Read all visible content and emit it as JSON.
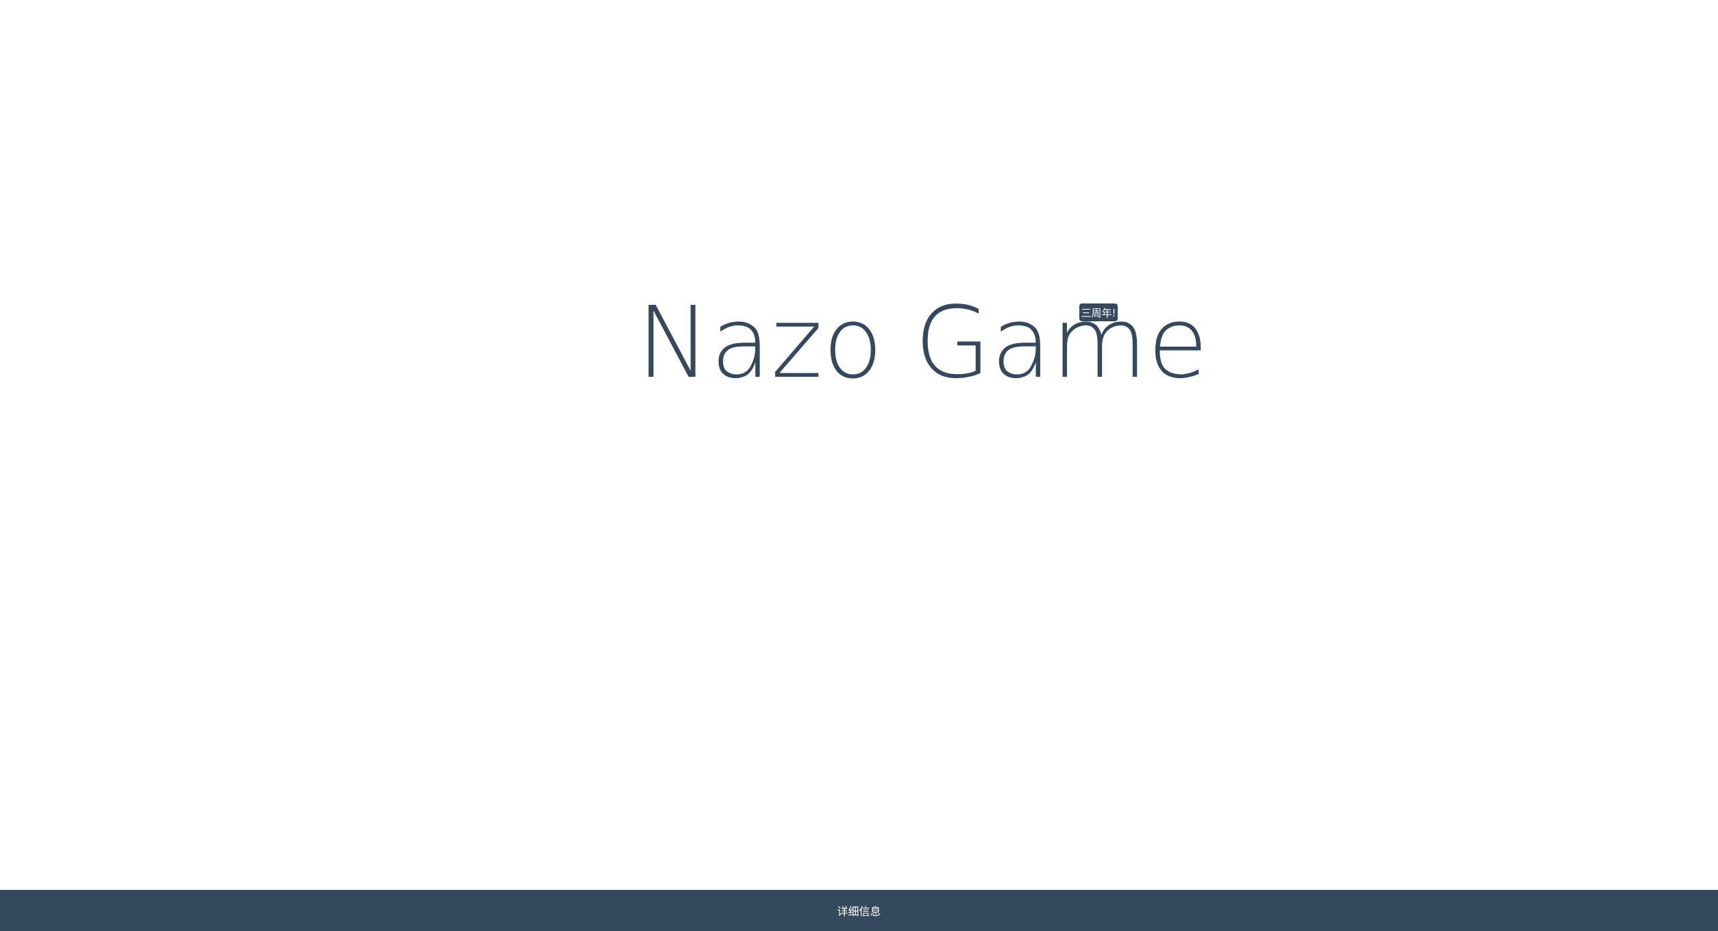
{
  "main": {
    "title": "Nazo Game",
    "badge": "三周年!"
  },
  "footer": {
    "details_label": "详细信息"
  },
  "colors": {
    "primary": "#34495e",
    "background": "#ffffff",
    "footer_text": "#ffffff"
  }
}
